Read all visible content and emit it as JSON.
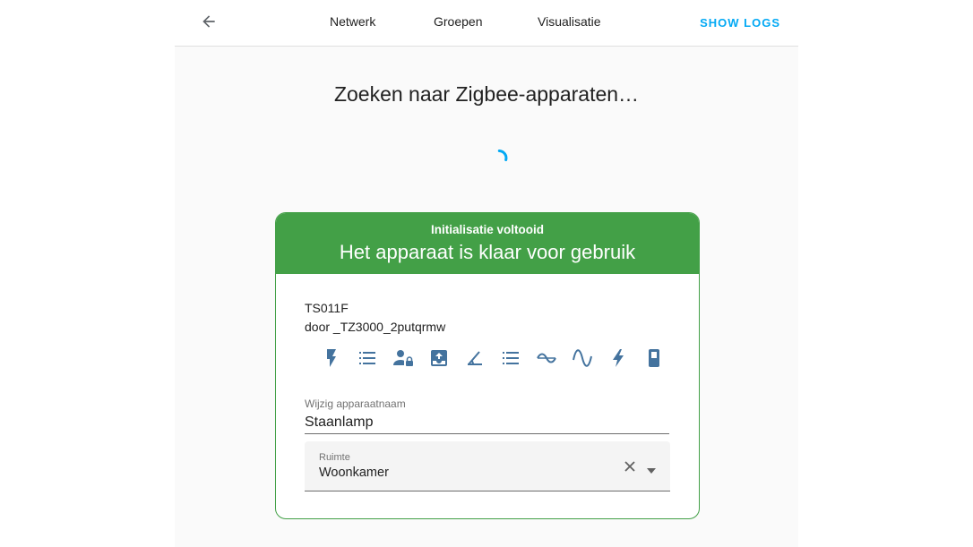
{
  "header": {
    "tabs": [
      {
        "label": "Netwerk"
      },
      {
        "label": "Groepen"
      },
      {
        "label": "Visualisatie"
      }
    ],
    "show_logs": "SHOW LOGS"
  },
  "search": {
    "title": "Zoeken naar Zigbee-apparaten…"
  },
  "device_card": {
    "status": "Initialisatie voltooid",
    "title": "Het apparaat is klaar voor gebruik",
    "model": "TS011F",
    "vendor": "door _TZ3000_2putqrmw",
    "entity_icons": [
      "flash-icon",
      "list-icon",
      "account-lock-icon",
      "inbox-arrow-up-icon",
      "angle-icon",
      "list-icon",
      "sine-wave-icon",
      "sine-wave-large-icon",
      "flash-icon",
      "battery-icon"
    ],
    "name_field": {
      "label": "Wijzig apparaatnaam",
      "value": "Staanlamp"
    },
    "room_field": {
      "label": "Ruimte",
      "value": "Woonkamer"
    }
  },
  "colors": {
    "accent": "#03a9f4",
    "success": "#43a047",
    "icon": "#44739e"
  }
}
